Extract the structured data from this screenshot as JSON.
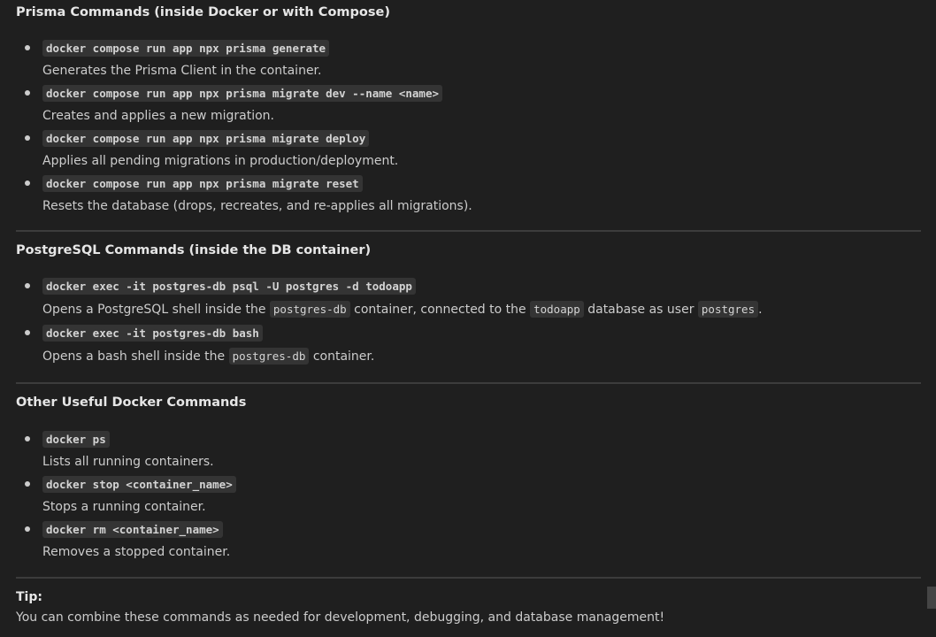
{
  "sections": [
    {
      "title": "Prisma Commands (inside Docker or with Compose)",
      "items": [
        {
          "cmd": "docker compose run app npx prisma generate",
          "desc": "Generates the Prisma Client in the container."
        },
        {
          "cmd": "docker compose run app npx prisma migrate dev --name <name>",
          "desc": "Creates and applies a new migration."
        },
        {
          "cmd": "docker compose run app npx prisma migrate deploy",
          "desc": "Applies all pending migrations in production/deployment."
        },
        {
          "cmd": "docker compose run app npx prisma migrate reset",
          "desc": "Resets the database (drops, recreates, and re-applies all migrations)."
        }
      ]
    },
    {
      "title": "PostgreSQL Commands (inside the DB container)",
      "items": [
        {
          "cmd": "docker exec -it postgres-db psql -U postgres -d todoapp",
          "desc_parts": [
            "Opens a PostgreSQL shell inside the ",
            "postgres-db",
            " container, connected to the ",
            "todoapp",
            " database as user ",
            "postgres",
            "."
          ]
        },
        {
          "cmd": "docker exec -it postgres-db bash",
          "desc_parts": [
            "Opens a bash shell inside the ",
            "postgres-db",
            " container."
          ]
        }
      ]
    },
    {
      "title": "Other Useful Docker Commands",
      "items": [
        {
          "cmd": "docker ps",
          "desc": "Lists all running containers."
        },
        {
          "cmd": "docker stop <container_name>",
          "desc": "Stops a running container."
        },
        {
          "cmd": "docker rm <container_name>",
          "desc": "Removes a stopped container."
        }
      ]
    }
  ],
  "tip": {
    "title": "Tip:",
    "text": "You can combine these commands as needed for development, debugging, and database management!"
  }
}
